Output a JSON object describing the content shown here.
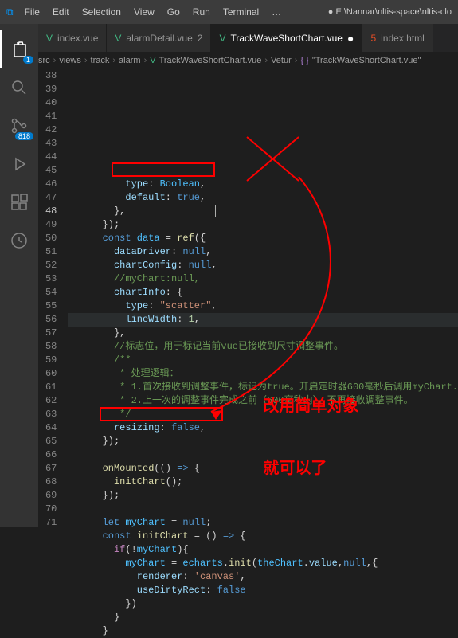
{
  "titlebar": {
    "menu": [
      "File",
      "Edit",
      "Selection",
      "View",
      "Go",
      "Run",
      "Terminal"
    ],
    "project": "E:\\Nannar\\nltis-space\\nltis-clo"
  },
  "tabs": [
    {
      "label": "index.vue",
      "icon": "vue",
      "active": false
    },
    {
      "label": "alarmDetail.vue",
      "icon": "vue",
      "active": false,
      "num": "2"
    },
    {
      "label": "TrackWaveShortChart.vue",
      "icon": "vue",
      "active": true,
      "modified": true
    },
    {
      "label": "index.html",
      "icon": "html",
      "active": false
    }
  ],
  "breadcrumb": {
    "parts": [
      "src",
      "views",
      "track",
      "alarm"
    ],
    "file": "TrackWaveShortChart.vue",
    "lang": "Vetur",
    "symbol": "\"TrackWaveShortChart.vue\""
  },
  "activity": {
    "explorer_badge": "1",
    "scm_badge": "818"
  },
  "lines": {
    "start": 38,
    "end": 71,
    "current": 48
  },
  "code": [
    {
      "n": 38,
      "t": "          type: Boolean,",
      "cls": [
        [
          "          ",
          "punct"
        ],
        [
          "type",
          "prop"
        ],
        [
          ": ",
          "punct"
        ],
        [
          "Boolean",
          "var"
        ],
        [
          ",",
          "punct"
        ]
      ]
    },
    {
      "n": 39,
      "t": "          default: true,",
      "cls": [
        [
          "          ",
          "punct"
        ],
        [
          "default",
          "prop"
        ],
        [
          ": ",
          "punct"
        ],
        [
          "true",
          "bool"
        ],
        [
          ",",
          "punct"
        ]
      ]
    },
    {
      "n": 40,
      "t": "        },",
      "cls": [
        [
          "        },",
          "punct"
        ]
      ]
    },
    {
      "n": 41,
      "t": "      });",
      "cls": [
        [
          "      });",
          "punct"
        ]
      ]
    },
    {
      "n": 42,
      "t": "      const data = ref({",
      "cls": [
        [
          "      ",
          "punct"
        ],
        [
          "const ",
          "kw"
        ],
        [
          "data",
          "var"
        ],
        [
          " = ",
          "punct"
        ],
        [
          "ref",
          "fn"
        ],
        [
          "({",
          "punct"
        ]
      ]
    },
    {
      "n": 43,
      "t": "        dataDriver: null,",
      "cls": [
        [
          "        ",
          "punct"
        ],
        [
          "dataDriver",
          "prop"
        ],
        [
          ": ",
          "punct"
        ],
        [
          "null",
          "bool"
        ],
        [
          ",",
          "punct"
        ]
      ]
    },
    {
      "n": 44,
      "t": "        chartConfig: null,",
      "cls": [
        [
          "        ",
          "punct"
        ],
        [
          "chartConfig",
          "prop"
        ],
        [
          ": ",
          "punct"
        ],
        [
          "null",
          "bool"
        ],
        [
          ",",
          "punct"
        ]
      ]
    },
    {
      "n": 45,
      "t": "        //myChart:null,",
      "cls": [
        [
          "        ",
          "punct"
        ],
        [
          "//myChart:null,",
          "cmt"
        ]
      ]
    },
    {
      "n": 46,
      "t": "        chartInfo: {",
      "cls": [
        [
          "        ",
          "punct"
        ],
        [
          "chartInfo",
          "prop"
        ],
        [
          ": ",
          "punct"
        ],
        [
          "{",
          "punct"
        ]
      ]
    },
    {
      "n": 47,
      "t": "          type: \"scatter\",",
      "cls": [
        [
          "          ",
          "punct"
        ],
        [
          "type",
          "prop"
        ],
        [
          ": ",
          "punct"
        ],
        [
          "\"scatter\"",
          "str"
        ],
        [
          ",",
          "punct"
        ]
      ]
    },
    {
      "n": 48,
      "t": "          lineWidth: 1,",
      "cls": [
        [
          "          ",
          "punct"
        ],
        [
          "lineWidth",
          "prop"
        ],
        [
          ": ",
          "punct"
        ],
        [
          "1",
          "num"
        ],
        [
          ",",
          "punct"
        ]
      ],
      "hl": true
    },
    {
      "n": 49,
      "t": "        },",
      "cls": [
        [
          "        },",
          "punct"
        ]
      ]
    },
    {
      "n": 50,
      "t": "        //标志位，用于标记当前vue已接收到尺寸调整事件。",
      "cls": [
        [
          "        ",
          "punct"
        ],
        [
          "//标志位，用于标记当前vue已接收到尺寸调整事件。",
          "cmt"
        ]
      ]
    },
    {
      "n": 51,
      "t": "        /**",
      "cls": [
        [
          "        ",
          "punct"
        ],
        [
          "/**",
          "cmt"
        ]
      ]
    },
    {
      "n": 52,
      "t": "         * 处理逻辑：",
      "cls": [
        [
          "         * 处理逻辑：",
          "cmt"
        ]
      ]
    },
    {
      "n": 53,
      "t": "         * 1.首次接收到调整事件，标记为true。开启定时器600毫秒后调用myChart.",
      "cls": [
        [
          "         * 1.首次接收到调整事件，标记为true。开启定时器600毫秒后调用myChart.",
          "cmt"
        ]
      ]
    },
    {
      "n": 54,
      "t": "         * 2.上一次的调整事件完成之前（600毫秒内），不再接收调整事件。",
      "cls": [
        [
          "         * 2.上一次的调整事件完成之前（600毫秒内），不再接收调整事件。",
          "cmt"
        ]
      ]
    },
    {
      "n": 55,
      "t": "         */",
      "cls": [
        [
          "         */",
          "cmt"
        ]
      ]
    },
    {
      "n": 56,
      "t": "        resizing: false,",
      "cls": [
        [
          "        ",
          "punct"
        ],
        [
          "resizing",
          "prop"
        ],
        [
          ": ",
          "punct"
        ],
        [
          "false",
          "bool"
        ],
        [
          ",",
          "punct"
        ]
      ]
    },
    {
      "n": 57,
      "t": "      });",
      "cls": [
        [
          "      });",
          "punct"
        ]
      ]
    },
    {
      "n": 58,
      "t": "",
      "cls": []
    },
    {
      "n": 59,
      "t": "      onMounted(() => {",
      "cls": [
        [
          "      ",
          "punct"
        ],
        [
          "onMounted",
          "fn"
        ],
        [
          "(() ",
          "punct"
        ],
        [
          "=>",
          "kw"
        ],
        [
          " {",
          "punct"
        ]
      ]
    },
    {
      "n": 60,
      "t": "        initChart();",
      "cls": [
        [
          "        ",
          "punct"
        ],
        [
          "initChart",
          "fn"
        ],
        [
          "();",
          "punct"
        ]
      ]
    },
    {
      "n": 61,
      "t": "      });",
      "cls": [
        [
          "      });",
          "punct"
        ]
      ]
    },
    {
      "n": 62,
      "t": "",
      "cls": []
    },
    {
      "n": 63,
      "t": "      let myChart = null;",
      "cls": [
        [
          "      ",
          "punct"
        ],
        [
          "let ",
          "kw"
        ],
        [
          "myChart",
          "var"
        ],
        [
          " = ",
          "punct"
        ],
        [
          "null",
          "bool"
        ],
        [
          ";",
          "punct"
        ]
      ]
    },
    {
      "n": 64,
      "t": "      const initChart = () => {",
      "cls": [
        [
          "      ",
          "punct"
        ],
        [
          "const ",
          "kw"
        ],
        [
          "initChart",
          "fn"
        ],
        [
          " = () ",
          "punct"
        ],
        [
          "=>",
          "kw"
        ],
        [
          " {",
          "punct"
        ]
      ]
    },
    {
      "n": 65,
      "t": "        if(!myChart){",
      "cls": [
        [
          "        ",
          "punct"
        ],
        [
          "if",
          "kw2"
        ],
        [
          "(!",
          "punct"
        ],
        [
          "myChart",
          "var"
        ],
        [
          "){",
          "punct"
        ]
      ]
    },
    {
      "n": 66,
      "t": "          myChart = echarts.init(theChart.value,null,{",
      "cls": [
        [
          "          ",
          "punct"
        ],
        [
          "myChart",
          "var"
        ],
        [
          " = ",
          "punct"
        ],
        [
          "echarts",
          "var"
        ],
        [
          ".",
          "punct"
        ],
        [
          "init",
          "fn"
        ],
        [
          "(",
          "punct"
        ],
        [
          "theChart",
          "var"
        ],
        [
          ".",
          "punct"
        ],
        [
          "value",
          "prop"
        ],
        [
          ",",
          "punct"
        ],
        [
          "null",
          "bool"
        ],
        [
          ",{",
          "punct"
        ]
      ]
    },
    {
      "n": 67,
      "t": "            renderer: 'canvas',",
      "cls": [
        [
          "            ",
          "punct"
        ],
        [
          "renderer",
          "prop"
        ],
        [
          ": ",
          "punct"
        ],
        [
          "'canvas'",
          "str"
        ],
        [
          ",",
          "punct"
        ]
      ]
    },
    {
      "n": 68,
      "t": "            useDirtyRect: false",
      "cls": [
        [
          "            ",
          "punct"
        ],
        [
          "useDirtyRect",
          "prop"
        ],
        [
          ": ",
          "punct"
        ],
        [
          "false",
          "bool"
        ]
      ]
    },
    {
      "n": 69,
      "t": "          })",
      "cls": [
        [
          "          })",
          "punct"
        ]
      ]
    },
    {
      "n": 70,
      "t": "        }",
      "cls": [
        [
          "        }",
          "punct"
        ]
      ]
    },
    {
      "n": 71,
      "t": "      }",
      "cls": [
        [
          "      }",
          "punct"
        ]
      ]
    }
  ],
  "annotations": {
    "text1": "改用简单对象",
    "text2": "就可以了"
  }
}
